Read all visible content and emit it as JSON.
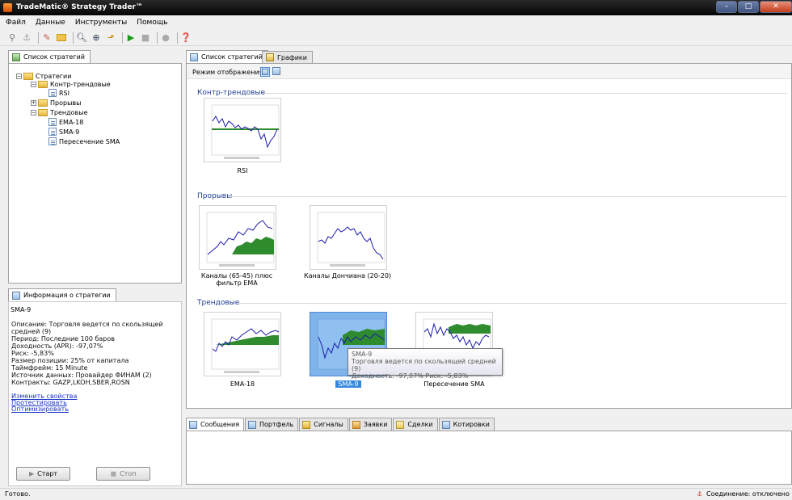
{
  "window": {
    "title": "TradeMatic® Strategy Trader™",
    "buttons": [
      "–",
      "□",
      "✕"
    ]
  },
  "menu": [
    "Файл",
    "Данные",
    "Инструменты",
    "Помощь"
  ],
  "toolbar": [
    "connect-icon",
    "disconnect-icon",
    "wand-icon",
    "open-folder-icon",
    "search-icon",
    "zoom-icon",
    "export-icon",
    "play-icon",
    "stop-icon",
    "record-icon",
    "help-icon"
  ],
  "left_tab": {
    "label": "Список стратегий"
  },
  "tree": {
    "root": "Стратегии",
    "groups": [
      {
        "label": "Контр-трендовые",
        "items": [
          "RSI"
        ]
      },
      {
        "label": "Прорывы",
        "items": []
      },
      {
        "label": "Трендовые",
        "items": [
          "EMA-18",
          "SMA-9",
          "Пересечение SMA"
        ]
      }
    ]
  },
  "info_tab": {
    "label": "Информация о стратегии"
  },
  "info": {
    "name": "SMA-9",
    "lines": [
      "Описание: Торговля ведется по скользящей",
      "средней (9)",
      "Период: Последние 100 баров",
      "Доходность (APR): -97,07%",
      "Риск: -5,83%",
      "Размер позиции: 25% от капитала",
      "Таймфрейм: 15 Minute",
      "Источник данных: Провайдер ФИНАМ (2)",
      "Контракты: GAZP,LKOH,SBER,ROSN"
    ],
    "links": [
      "Изменить свойства",
      "Протестировать",
      "Оптимизировать"
    ]
  },
  "buttons": {
    "start": "Старт",
    "stop": "Стоп"
  },
  "main_tabs": [
    "Список стратегий",
    "Графики"
  ],
  "view_mode": {
    "label": "Режим отображения:"
  },
  "groups": [
    {
      "title": "Контр-трендовые",
      "items": [
        {
          "label": "RSI"
        }
      ]
    },
    {
      "title": "Прорывы",
      "items": [
        {
          "label": "Каналы (65-45) плюс фильтр EMA"
        },
        {
          "label": "Каналы Дончиана (20-20)"
        }
      ]
    },
    {
      "title": "Трендовые",
      "items": [
        {
          "label": "EMA-18"
        },
        {
          "label": "SMA-9"
        },
        {
          "label": "Пересечение SMA"
        }
      ]
    }
  ],
  "tooltip": {
    "title": "SMA-9",
    "line1": "Торговля ведется по скользящей средней (9)",
    "line2": "Доходность: -97,07% Риск: -5,83%"
  },
  "bottom_tabs": [
    "Сообщения",
    "Портфель",
    "Сигналы",
    "Заявки",
    "Сделки",
    "Котировки"
  ],
  "status": {
    "left": "Готово.",
    "right": "Соединение: отключено"
  },
  "colors": {
    "accent": "#3388dd",
    "line": "#1a1aa8",
    "fill": "#2e8b2e",
    "link": "#1a35c6"
  }
}
